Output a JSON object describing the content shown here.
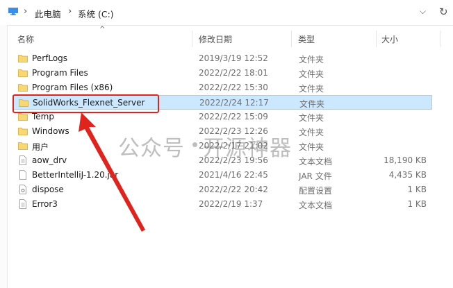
{
  "address": {
    "crumbs": [
      "此电脑",
      "系统 (C:)"
    ],
    "separator": "›"
  },
  "columns": {
    "name": "名称",
    "date": "修改日期",
    "type": "类型",
    "size": "大小"
  },
  "files": [
    {
      "name": "PerfLogs",
      "date": "2019/3/19 12:52",
      "type": "文件夹",
      "size": "",
      "icon": "folder-icon"
    },
    {
      "name": "Program Files",
      "date": "2022/2/22 18:01",
      "type": "文件夹",
      "size": "",
      "icon": "folder-icon"
    },
    {
      "name": "Program Files (x86)",
      "date": "2022/2/22 15:30",
      "type": "文件夹",
      "size": "",
      "icon": "folder-icon"
    },
    {
      "name": "SolidWorks_Flexnet_Server",
      "date": "2022/2/24 12:17",
      "type": "文件夹",
      "size": "",
      "icon": "folder-icon",
      "selected": true
    },
    {
      "name": "Temp",
      "date": "2022/2/22 15:09",
      "type": "文件夹",
      "size": "",
      "icon": "folder-icon"
    },
    {
      "name": "Windows",
      "date": "2022/2/23 12:26",
      "type": "文件夹",
      "size": "",
      "icon": "folder-icon"
    },
    {
      "name": "用户",
      "date": "2022/2/17 21:02",
      "type": "文件夹",
      "size": "",
      "icon": "folder-icon"
    },
    {
      "name": "aow_drv",
      "date": "2022/2/23 19:56",
      "type": "文本文档",
      "size": "18,190 KB",
      "icon": "text-file-icon"
    },
    {
      "name": "BetterIntelliJ-1.20.jar",
      "date": "2021/4/16 22:45",
      "type": "JAR 文件",
      "size": "4,435 KB",
      "icon": "jar-file-icon"
    },
    {
      "name": "dispose",
      "date": "2022/2/22 20:42",
      "type": "配置设置",
      "size": "1 KB",
      "icon": "config-file-icon"
    },
    {
      "name": "Error3",
      "date": "2022/2/19 1:37",
      "type": "文本文档",
      "size": "1 KB",
      "icon": "text-file-icon"
    }
  ],
  "watermark": {
    "left": "公众号",
    "right": "开源神器"
  },
  "colors": {
    "folder": "#f8d775",
    "selection": "#cce8ff",
    "highlight": "#e0231c"
  }
}
